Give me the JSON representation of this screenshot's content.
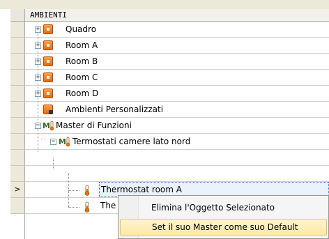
{
  "grid": {
    "header": "AMBIENTI",
    "current_row_marker": ">"
  },
  "tree": [
    {
      "label": "Quadro",
      "icon": "room-icon",
      "expander": "+"
    },
    {
      "label": "Room A",
      "icon": "room-icon",
      "expander": "+"
    },
    {
      "label": "Room B",
      "icon": "room-icon",
      "expander": "+"
    },
    {
      "label": "Room C",
      "icon": "room-icon",
      "expander": "+"
    },
    {
      "label": "Room D",
      "icon": "room-icon",
      "expander": "+"
    },
    {
      "label": "Ambienti Personalizzati",
      "icon": "custom-room-icon",
      "expander": ""
    },
    {
      "label": "Master di Funzioni",
      "icon": "master-icon",
      "expander": "−"
    },
    {
      "label": "Termostati camere lato nord",
      "icon": "master-icon",
      "expander": "−"
    },
    {
      "label": "Thermostat room A",
      "icon": "thermometer-icon",
      "expander": ""
    },
    {
      "label": "The",
      "icon": "thermometer-icon",
      "expander": ""
    }
  ],
  "context_menu": {
    "items": [
      {
        "label": "Elimina l'Oggetto Selezionato"
      },
      {
        "label": "Set il suo Master come suo Default"
      }
    ]
  },
  "colors": {
    "room_icon": "#e46a10",
    "selection_border": "#3a6bc0",
    "menu_hover": "#fde8a6",
    "thermometer": "#e07a10"
  }
}
